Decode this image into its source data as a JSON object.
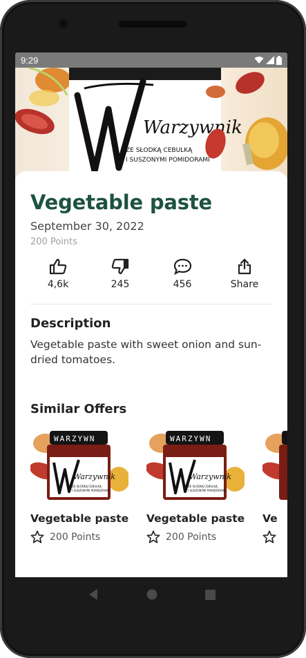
{
  "status_bar": {
    "time": "9:29"
  },
  "product": {
    "title": "Vegetable paste",
    "date": "September 30, 2022",
    "points": "200 Points"
  },
  "actions": [
    {
      "icon": "thumbs-up-icon",
      "label": "4,6k"
    },
    {
      "icon": "thumbs-down-icon",
      "label": "245"
    },
    {
      "icon": "comment-icon",
      "label": "456"
    },
    {
      "icon": "share-icon",
      "label": "Share"
    }
  ],
  "description": {
    "heading": "Description",
    "text": "Vegetable paste with sweet onion and sun-dried tomatoes."
  },
  "similar": {
    "heading": "Similar Offers",
    "offers": [
      {
        "title": "Vegetable paste",
        "points": "200 Points"
      },
      {
        "title": "Vegetable paste",
        "points": "200 Points"
      },
      {
        "title": "Ve",
        "points": ""
      }
    ]
  },
  "hero_label": {
    "brand": "Warzywnik",
    "sub1": "ZE SŁODKĄ CEBULKĄ",
    "sub2": "I SUSZONYMI POMIDORAMI"
  },
  "jar_label": {
    "lid": "WARZYWN",
    "brand": "Warzywnik",
    "sub1": "ZE SŁODKĄ CEBULKĄ",
    "sub2": "I SUSZONYMI POMIDORAMI"
  },
  "colors": {
    "title": "#1e5243",
    "statusbar": "#7a7a7a"
  }
}
